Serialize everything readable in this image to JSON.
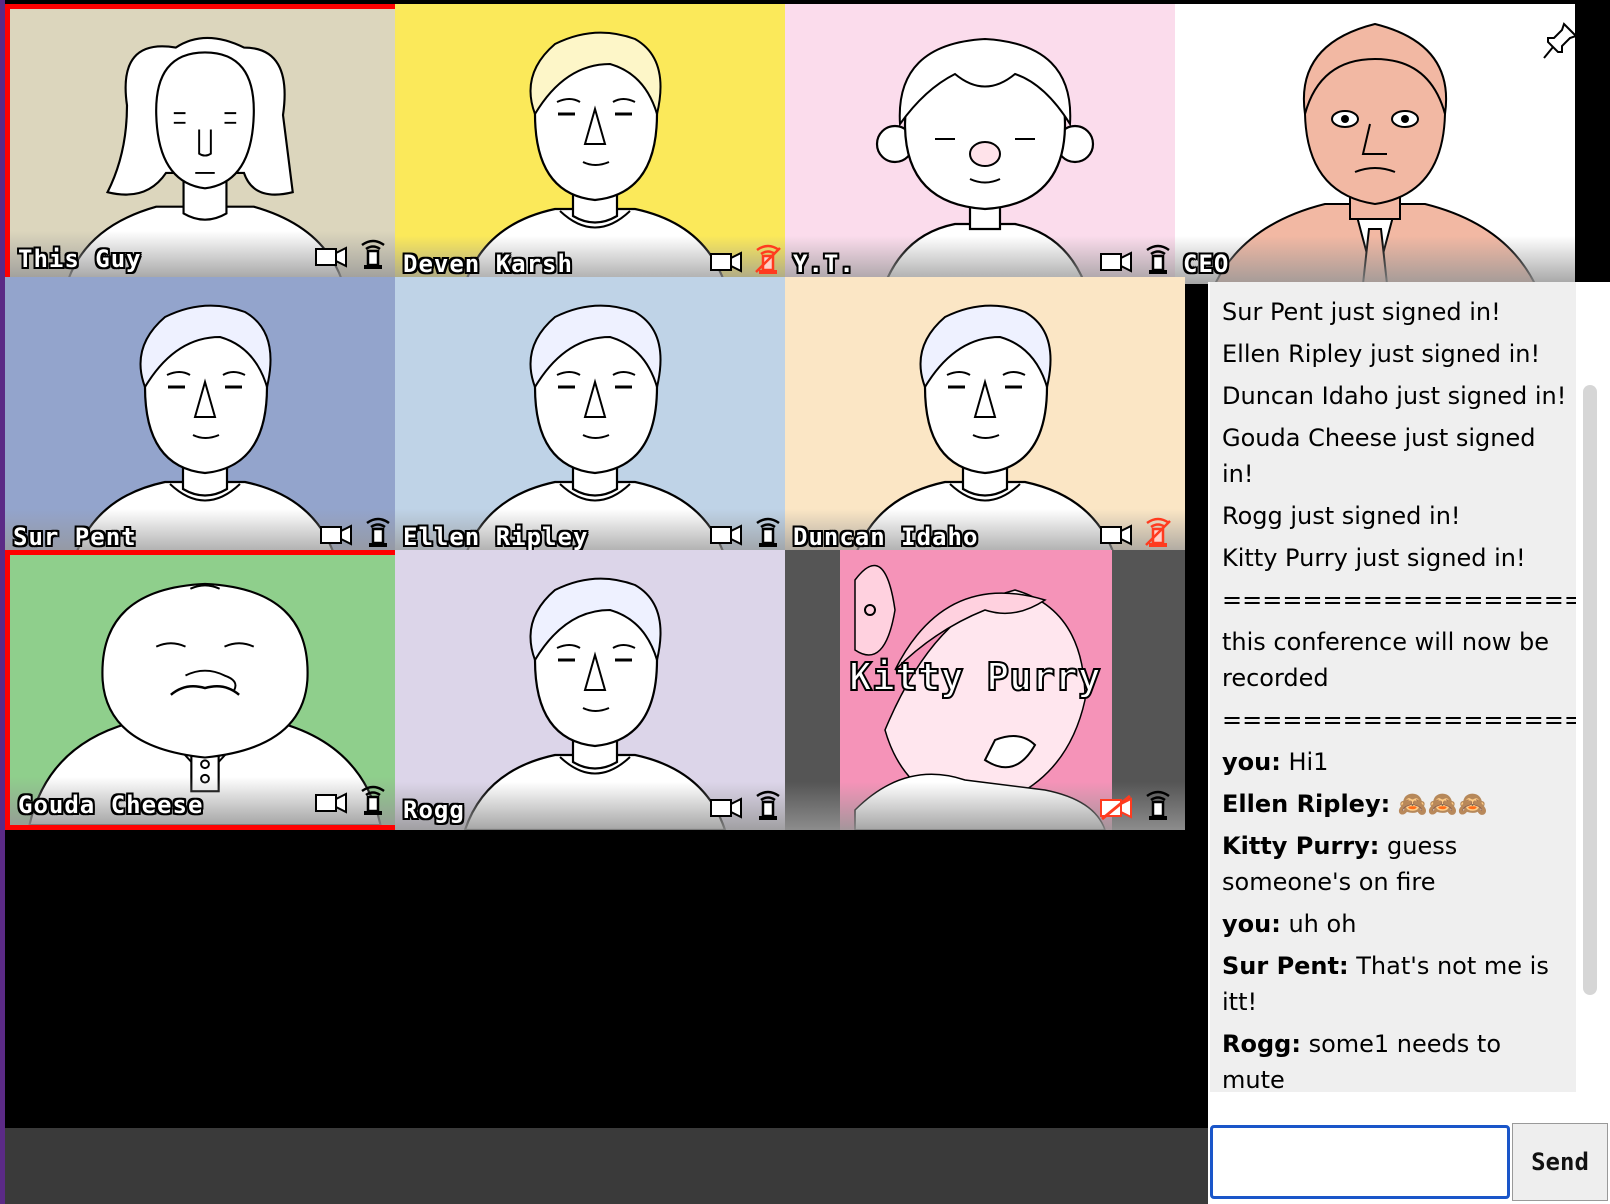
{
  "tiles": [
    {
      "name": "This Guy",
      "bg": "#dcd6bd",
      "speaking": true,
      "face": "longhair",
      "cam": "on",
      "mic": "on"
    },
    {
      "name": "Deven Karsh",
      "bg": "#fbe95a",
      "speaking": false,
      "face": "blond",
      "cam": "on",
      "mic": "muted"
    },
    {
      "name": "Y.T.",
      "bg": "#fbdcec",
      "speaking": false,
      "face": "kid",
      "cam": "on",
      "mic": "on"
    },
    {
      "name": "CEO",
      "bg": "#ffffff",
      "speaking": false,
      "face": "ceo",
      "cam": "none",
      "mic": "none"
    },
    {
      "name": "Sur Pent",
      "bg": "#93a4cc",
      "speaking": false,
      "face": "default",
      "cam": "on",
      "mic": "on"
    },
    {
      "name": "Ellen Ripley",
      "bg": "#bfd3e7",
      "speaking": false,
      "face": "default",
      "cam": "on",
      "mic": "on"
    },
    {
      "name": "Duncan Idaho",
      "bg": "#fbe6c5",
      "speaking": false,
      "face": "default",
      "cam": "on",
      "mic": "muted"
    },
    {
      "name": "Gouda Cheese",
      "bg": "#8fcf8c",
      "speaking": true,
      "face": "big",
      "cam": "on",
      "mic": "on"
    },
    {
      "name": "Rogg",
      "bg": "#dcd5e9",
      "speaking": false,
      "face": "default",
      "cam": "on",
      "mic": "on"
    },
    {
      "name": "Kitty Purry",
      "bg": "#555555",
      "speaking": false,
      "face": "kitty",
      "cam": "off",
      "mic": "on"
    }
  ],
  "chat": {
    "messages": [
      {
        "who": "",
        "text": "Sur Pent just signed in!"
      },
      {
        "who": "",
        "text": "Ellen Ripley just signed in!"
      },
      {
        "who": "",
        "text": "Duncan Idaho just signed in!"
      },
      {
        "who": "",
        "text": "Gouda Cheese just signed in!"
      },
      {
        "who": "",
        "text": "Rogg just signed in!"
      },
      {
        "who": "",
        "text": "Kitty Purry just signed in!"
      },
      {
        "who": "",
        "text": "=========================="
      },
      {
        "who": "",
        "text": "this conference will now be recorded"
      },
      {
        "who": "",
        "text": "=========================="
      },
      {
        "who": "you",
        "text": " Hi1"
      },
      {
        "who": "Ellen Ripley",
        "text": " 🙈🙈🙈"
      },
      {
        "who": "Kitty Purry",
        "text": " guess someone's on fire"
      },
      {
        "who": "you",
        "text": " uh oh"
      },
      {
        "who": "Sur Pent",
        "text": " That's not me is itt!"
      },
      {
        "who": "Rogg",
        "text": " some1 needs to mute"
      }
    ],
    "input_value": "",
    "send_label": "Send"
  },
  "colors": {
    "speaking_border": "#ff0000",
    "muted_icon": "#ff3b1f",
    "input_border": "#1a56c9"
  }
}
